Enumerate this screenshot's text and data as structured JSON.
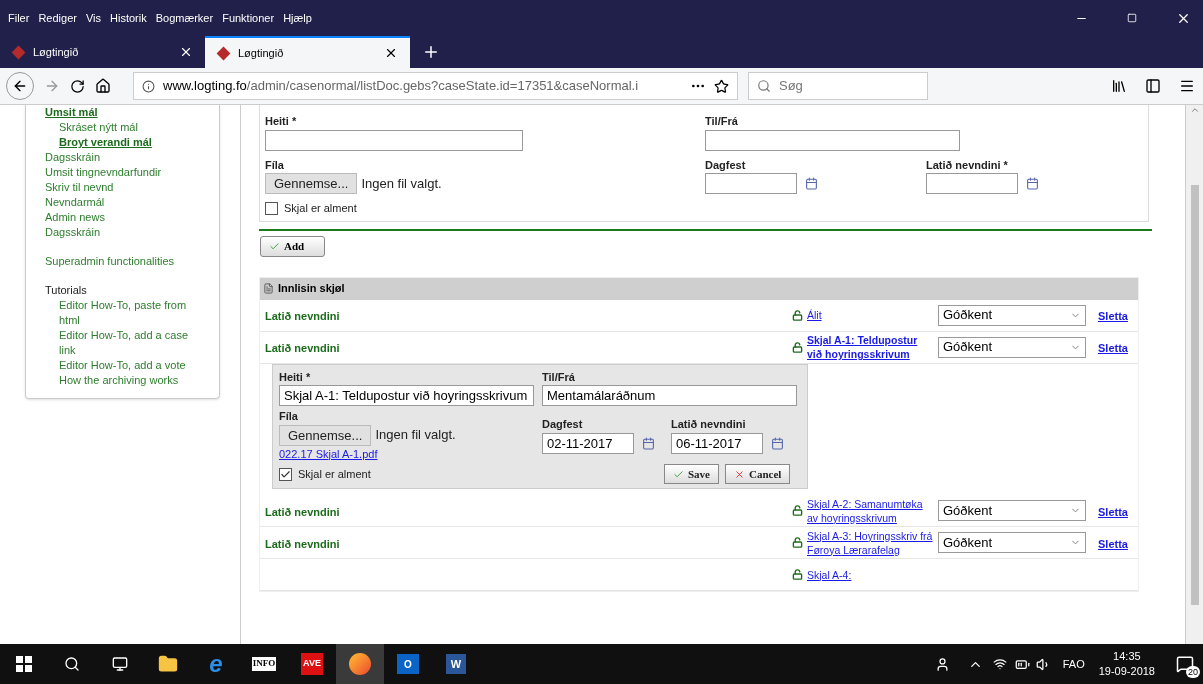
{
  "menu_bar": [
    "Filer",
    "Rediger",
    "Vis",
    "Historik",
    "Bogmærker",
    "Funktioner",
    "Hjælp"
  ],
  "tabs": [
    {
      "label": "Løgtingið",
      "selected": false
    },
    {
      "label": "Løgtingið",
      "selected": true
    }
  ],
  "address": {
    "host": "www.logting.fo",
    "path": "/admin/casenormal/listDoc.gebs?caseState.id=17351&caseNormal.i"
  },
  "search": {
    "placeholder": "Søg"
  },
  "sidebar": [
    {
      "label": "Umsit mál",
      "kind": "current",
      "children": [
        {
          "label": "Skráset nýtt mál",
          "kind": "link"
        },
        {
          "label": "Broyt verandi mál",
          "kind": "current"
        }
      ]
    },
    {
      "label": "Dagsskráin",
      "kind": "link"
    },
    {
      "label": "Umsit tingnevndarfundir",
      "kind": "link"
    },
    {
      "label": "Skriv til nevnd",
      "kind": "link"
    },
    {
      "label": "Nevndarmál",
      "kind": "link"
    },
    {
      "label": "Admin news",
      "kind": "link"
    },
    {
      "label": "Dagsskráin",
      "kind": "link"
    },
    {
      "label": "Superadmin functionalities",
      "kind": "section"
    },
    {
      "label": "Tutorials",
      "kind": "heading",
      "children": [
        {
          "label": "Editor How-To, paste from html",
          "kind": "link"
        },
        {
          "label": "Editor How-To, add a case link",
          "kind": "link"
        },
        {
          "label": "Editor How-To, add a vote",
          "kind": "link"
        },
        {
          "label": "How the archiving works",
          "kind": "link"
        }
      ]
    }
  ],
  "new_form": {
    "title_label": "Heiti *",
    "to_from_label": "Til/Frá",
    "file_label": "Fíla",
    "browse": "Gennemse...",
    "no_file": "Ingen fil valgt.",
    "date_label": "Dagfest",
    "sent_label": "Latið nevndini *",
    "public_label": "Skjal er alment",
    "public_checked": false,
    "add_button": "Add"
  },
  "documents": {
    "heading": "Innlisin skjøl",
    "rows": [
      {
        "status": "Latið nevndini",
        "link": "Álit",
        "approval": "Góðkent",
        "delete": "Sletta",
        "expanded": false
      },
      {
        "status": "Latið nevndini",
        "link": "Skjal A-1: Teldupostur við hoyringsskrivum",
        "approval": "Góðkent",
        "delete": "Sletta",
        "expanded": true
      },
      {
        "status": "Latið nevndini",
        "link": "Skjal A-2: Samanumtøka av hoyringsskrivum",
        "approval": "Góðkent",
        "delete": "Sletta",
        "expanded": false
      },
      {
        "status": "Latið nevndini",
        "link": "Skjal A-3: Hoyringsskriv frá Føroya Lærarafelag",
        "approval": "Góðkent",
        "delete": "Sletta",
        "expanded": false
      },
      {
        "link": "Skjal A-4:",
        "expanded": false
      }
    ]
  },
  "edit_form": {
    "title_label": "Heiti *",
    "title_value": "Skjal A-1: Teldupostur við hoyringsskrivum",
    "to_from_label": "Til/Frá",
    "to_from_value": "Mentamálaráðnum",
    "file_label": "Fíla",
    "browse": "Gennemse...",
    "no_file": "Ingen fil valgt.",
    "file_link": "022.17 Skjal A-1.pdf",
    "date_label": "Dagfest",
    "date_value": "02-11-2017",
    "sent_label": "Latið nevndini",
    "sent_value": "06-11-2017",
    "public_label": "Skjal er alment",
    "public_checked": true,
    "save": "Save",
    "cancel": "Cancel"
  },
  "taskbar": {
    "apps": [
      {
        "kind": "explorer"
      },
      {
        "kind": "edge",
        "label": "e"
      },
      {
        "kind": "info",
        "label": "INFO"
      },
      {
        "kind": "ave",
        "label": "AVE"
      },
      {
        "kind": "firefox"
      },
      {
        "kind": "outlook",
        "label": "O"
      },
      {
        "kind": "word",
        "label": "W"
      }
    ],
    "language": "FAO",
    "time": "14:35",
    "date": "19-09-2018",
    "notifications": "20"
  }
}
